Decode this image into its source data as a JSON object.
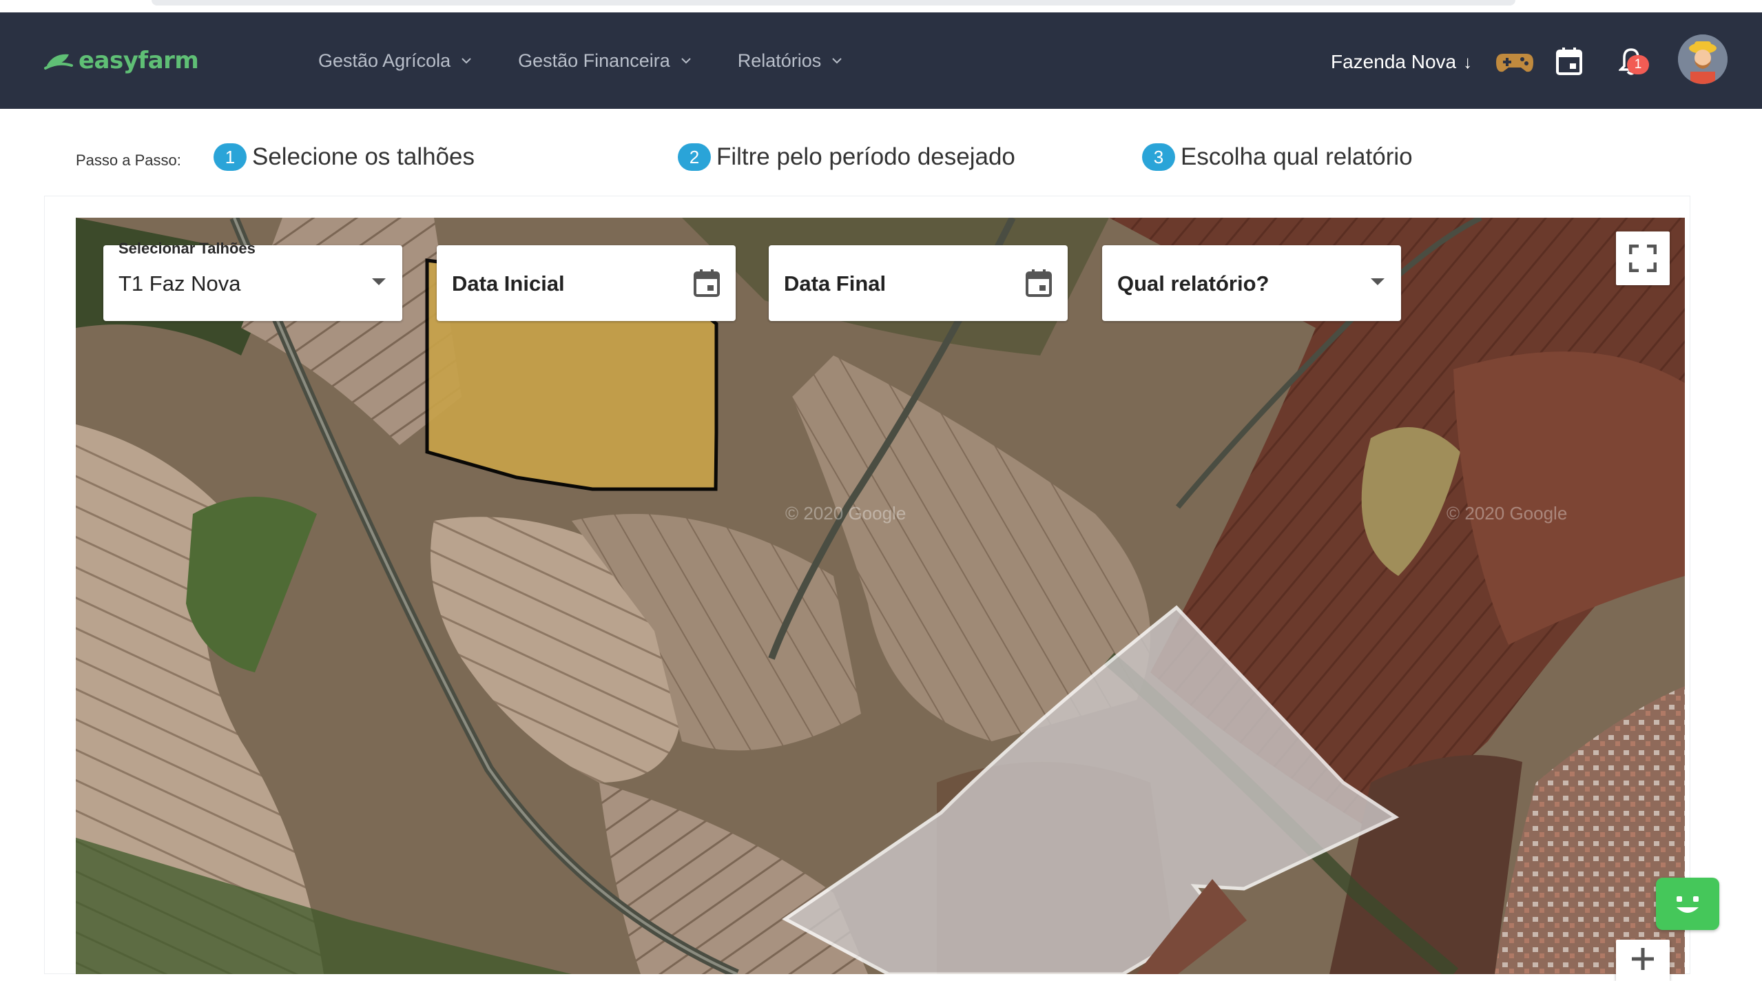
{
  "app": {
    "logo_text": "easyfarm"
  },
  "nav": {
    "items": [
      {
        "label": "Gestão Agrícola"
      },
      {
        "label": "Gestão Financeira"
      },
      {
        "label": "Relatórios"
      }
    ],
    "farm_selector": "Fazenda Nova",
    "notification_count": "1",
    "icons": [
      "gamepad-icon",
      "calendar-icon",
      "bell-icon",
      "avatar-farmer"
    ]
  },
  "steps": {
    "label": "Passo a Passo:",
    "items": [
      {
        "number": "1",
        "text": "Selecione os talhões"
      },
      {
        "number": "2",
        "text": "Filtre pelo período desejado"
      },
      {
        "number": "3",
        "text": "Escolha qual relatório"
      }
    ]
  },
  "filters": {
    "plots_label": "Selecionar Talhões",
    "plots_value": "T1 Faz Nova",
    "start_date": "Data Inicial",
    "end_date": "Data Final",
    "report": "Qual relatório?"
  },
  "map": {
    "watermark": "© 2020 Google",
    "colors": {
      "selected_plot_fill": "#c7a24a",
      "highlight_plot_fill": "#c9c4c4",
      "highlight_plot_stroke": "#ffffff"
    }
  },
  "colors": {
    "navbar": "#2a3142",
    "brand_green": "#5fbf75",
    "step_badge": "#2aa4d8",
    "notification_badge": "#f25c54",
    "chat_button": "#45c75a"
  }
}
